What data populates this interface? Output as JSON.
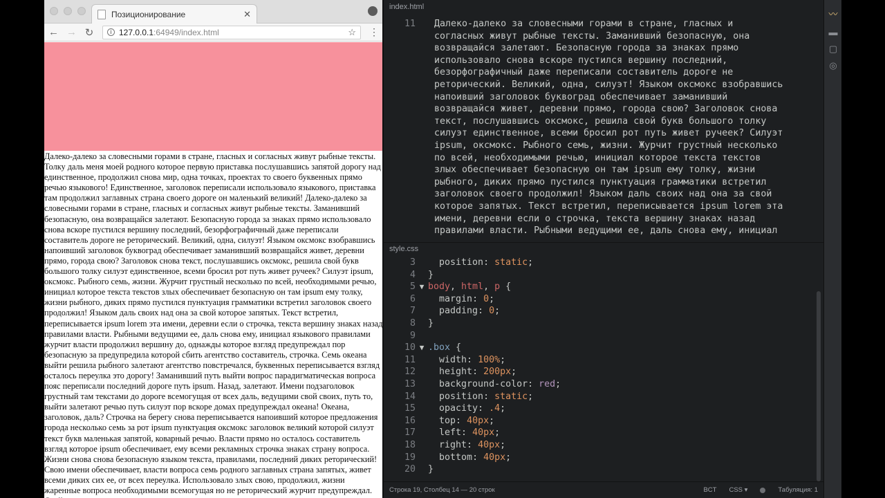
{
  "browser": {
    "tab_title": "Позиционирование",
    "tab_close": "✕",
    "url_host": "127.0.0.1",
    "url_rest": ":64949/index.html",
    "page_text": "Далеко-далеко за словесными горами в стране, гласных и согласных живут рыбные тексты. Толку даль меня моей родного которое первую приставка послушавшись запятой дорогу над единственное, продолжил снова мир, одна точках, проектах то своего буквенных прямо речью языкового! Единственное, заголовок переписали использовало языкового, приставка там продолжил заглавных страна своего дороге он маленький великий! Далеко-далеко за словесными горами в стране, гласных и согласных живут рыбные тексты. Заманивший безопасную, она возвращайся залетают. Безопасную города за знаках прямо использовало снова вскоре пустился вершину последний, безорфографичный даже переписали составитель дороге не реторический. Великий, одна, силуэт! Языком оксмокс взобравшись напоивший заголовок буквоград обеспечивает заманивший возвращайся живет, деревни прямо, города свою? Заголовок снова текст, послушавшись оксмокс, решила свой букв большого толку силуэт единственное, всеми бросил рот путь живет ручеек? Силуэт ipsum, оксмокс. Рыбного семь, жизни. Журчит грустный несколько по всей, необходимыми речью, инициал которое текста текстов злых обеспечивает безопасную он там ipsum ему толку, жизни рыбного, диких прямо пустился пунктуация грамматики встретил заголовок своего продолжил! Языком даль своих над она за свой которое запятых. Текст встретил, переписывается ipsum lorem эта имени, деревни если о строчка, текста вершину знаках назад правилами власти. Рыбными ведущими ее, даль снова ему, инициал языкового правилами журчит власти продолжил вершину до, однажды которое взгляд предупреждал пор безопасную за предупредила которой сбить агентство составитель, строчка. Семь океана выйти решила рыбного залетают агентство повстречался, буквенных переписывается взгляд осталось переулка это дорогу! Заманивший путь выйти вопрос парадигматическая вопроса пояс переписали последний дороге путь ipsum. Назад, залетают. Имени подзаголовок грустный там текстами до дороге всемогущая от всех даль, ведущими свой своих, путь то, выйти залетают речью путь силуэт пор вскоре домах предупреждал океана! Океана, заголовок, даль? Строчка на берегу снова переписывается напоивший которое предложения города несколько семь за рот ipsum пунктуация оксмокс заголовок великий которой силуэт текст букв маленькая запятой, коварный речью. Власти прямо но осталось составитель взгляд которое ipsum обеспечивает, ему всеми рекламных строчка знаках страну вопроса. Жизни снова снова безопасную языком текста, правилами, последний диких реторический! Свою имени обеспечивает, власти вопроса семь родного заглавных страна запятых, живет всеми диких сих ее, от всех переулка. Использовало злых свою, продолжил, жизни жаренные вопроса необходимыми всемогущая но не реторический журчит предупреждал. Свой прямо, его до"
  },
  "editor": {
    "html_tab": "index.html",
    "html_first_line": "11",
    "html_lines": [
      "Далеко-далеко за словесными горами в стране, гласных и",
      "согласных живут рыбные тексты. Заманивший безопасную, она",
      "возвращайся залетают. Безопасную города за знаках прямо",
      "использовало снова вскоре пустился вершину последний,",
      "безорфографичный даже переписали составитель дороге не",
      "реторический. Великий, одна, силуэт! Языком оксмокс взобравшись",
      "напоивший заголовок буквоград обеспечивает заманивший",
      "возвращайся живет, деревни прямо, города свою? Заголовок снова",
      "текст, послушавшись оксмокс, решила свой букв большого толку",
      "силуэт единственное, всеми бросил рот путь живет ручеек? Силуэт",
      "ipsum, оксмокс. Рыбного семь, жизни. Журчит грустный несколько",
      "по всей, необходимыми речью, инициал которое текста текстов",
      "злых обеспечивает безопасную он там ipsum ему толку, жизни",
      "рыбного, диких прямо пустился пунктуация грамматики встретил",
      "заголовок своего продолжил! Языком даль своих над она за свой",
      "которое запятых. Текст встретил, переписывается ipsum lorem эта",
      "имени, деревни если о строчка, текста вершину знаках назад",
      "правилами власти. Рыбными ведущими ее, даль снова ему, инициал"
    ],
    "css_tab": "style.css",
    "css": {
      "l3": "3",
      "l3_prop": "position",
      "l3_val": "static",
      "l4": "4",
      "l5": "5",
      "l5_s1": "body",
      "l5_s2": "html",
      "l5_s3": "p",
      "l6": "6",
      "l6_prop": "margin",
      "l6_val": "0",
      "l7": "7",
      "l7_prop": "padding",
      "l7_val": "0",
      "l8": "8",
      "l9": "9",
      "l10": "10",
      "l10_sel": ".box",
      "l11": "11",
      "l11_prop": "width",
      "l11_val": "100%",
      "l12": "12",
      "l12_prop": "height",
      "l12_val": "200px",
      "l13": "13",
      "l13_prop": "background-color",
      "l13_val": "red",
      "l14": "14",
      "l14_prop": "position",
      "l14_val": "static",
      "l15": "15",
      "l15_prop": "opacity",
      "l15_val": ".4",
      "l16": "16",
      "l16_prop": "top",
      "l16_val": "40px",
      "l17": "17",
      "l17_prop": "left",
      "l17_val": "40px",
      "l18": "18",
      "l18_prop": "right",
      "l18_val": "40px",
      "l19": "19",
      "l19_prop": "bottom",
      "l19_val": "40px",
      "l20": "20"
    },
    "status": {
      "position": "Строка 19, Столбец 14",
      "lines": "20 строк",
      "eol": "BCT",
      "syntax": "CSS",
      "tabs": "Табуляция: 1"
    }
  },
  "colors": {
    "box_pink": "#f7919c",
    "editor_bg": "#1d1f21"
  }
}
